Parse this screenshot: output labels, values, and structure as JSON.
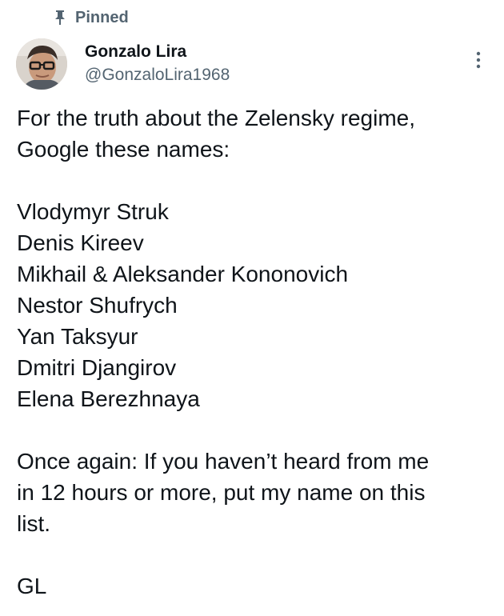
{
  "pinned": {
    "icon": "pin-icon",
    "label": "Pinned"
  },
  "author": {
    "display_name": "Gonzalo Lira",
    "handle": "@GonzaloLira1968",
    "avatar_icon": "avatar"
  },
  "menu": {
    "icon": "more-vertical-icon"
  },
  "tweet": {
    "intro": [
      "For the truth about the Zelensky regime,",
      "Google these names:"
    ],
    "names": [
      "Vlodymyr Struk",
      "Denis Kireev",
      "Mikhail & Aleksander Kononovich",
      "Nestor Shufrych",
      "Yan Taksyur",
      "Dmitri Djangirov",
      "Elena Berezhnaya"
    ],
    "closing": [
      "Once again: If you haven’t heard from me",
      "in 12 hours or more, put my name on this",
      "list."
    ],
    "signature": "GL"
  },
  "colors": {
    "text": "#0f1419",
    "secondary": "#536471"
  }
}
